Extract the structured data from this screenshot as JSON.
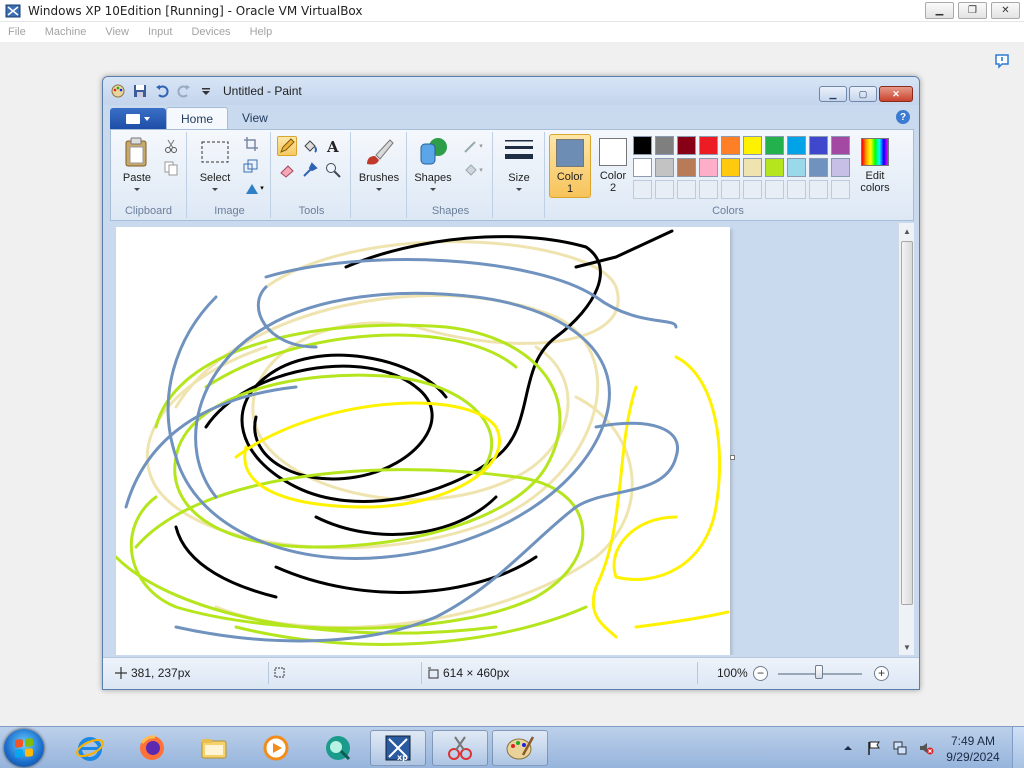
{
  "vbox": {
    "title": "Windows XP 10Edition [Running] - Oracle VM VirtualBox",
    "menu": [
      "File",
      "Machine",
      "View",
      "Input",
      "Devices",
      "Help"
    ]
  },
  "paint": {
    "title": "Untitled - Paint",
    "tabs": [
      "Home",
      "View"
    ],
    "ribbon": {
      "clipboard": {
        "label": "Clipboard",
        "paste": "Paste"
      },
      "image": {
        "label": "Image",
        "select": "Select"
      },
      "tools": {
        "label": "Tools"
      },
      "brushes": "Brushes",
      "shapes": {
        "label": "Shapes",
        "button": "Shapes"
      },
      "size": "Size",
      "colors": {
        "label": "Colors",
        "color1": {
          "line1": "Color",
          "line2": "1",
          "value": "#6d8db5"
        },
        "color2": {
          "line1": "Color",
          "line2": "2",
          "value": "#ffffff"
        },
        "edit": {
          "line1": "Edit",
          "line2": "colors"
        },
        "palette_row1": [
          "#000000",
          "#7f7f7f",
          "#880015",
          "#ed1c24",
          "#ff7f27",
          "#fff200",
          "#22b14c",
          "#00a2e8",
          "#3f48cc",
          "#a349a4"
        ],
        "palette_row2": [
          "#ffffff",
          "#c3c3c3",
          "#b97a57",
          "#ffaec9",
          "#ffc90e",
          "#efe4b0",
          "#b5e61d",
          "#99d9ea",
          "#7092be",
          "#c8bfe7"
        ]
      }
    },
    "status": {
      "cursor": "381, 237px",
      "canvas_size": "614 × 460px",
      "zoom": "100%"
    }
  },
  "taskbar": {
    "clock_time": "7:49 AM",
    "clock_date": "9/29/2024"
  }
}
